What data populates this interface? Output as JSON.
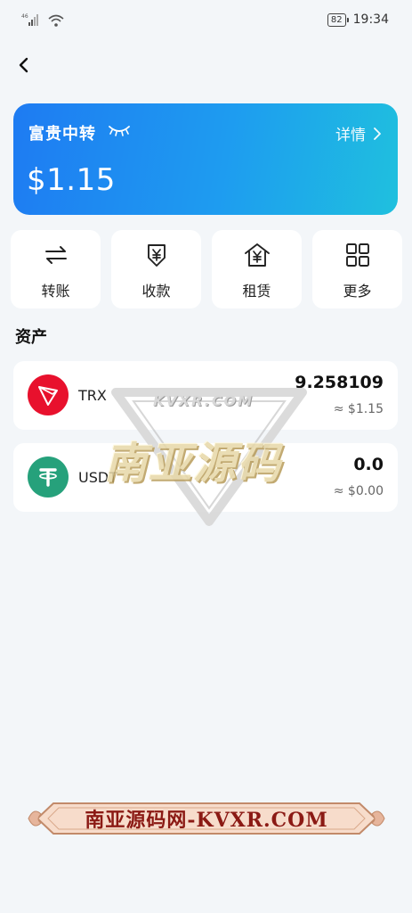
{
  "status_bar": {
    "network": "46",
    "battery": "82",
    "time": "19:34"
  },
  "wallet": {
    "name": "富贵中转",
    "detail_label": "详情",
    "balance": "$1.15"
  },
  "actions": [
    {
      "label": "转账",
      "icon": "transfer-icon"
    },
    {
      "label": "收款",
      "icon": "receive-icon"
    },
    {
      "label": "租赁",
      "icon": "lease-icon"
    },
    {
      "label": "更多",
      "icon": "grid-icon"
    }
  ],
  "assets_title": "资产",
  "assets": [
    {
      "symbol": "TRX",
      "amount": "9.258109",
      "fiat": "≈ $1.15",
      "icon": "trx-icon"
    },
    {
      "symbol": "USDT",
      "amount": "0.0",
      "fiat": "≈ $0.00",
      "icon": "usdt-icon"
    }
  ],
  "watermark": {
    "small": "KVXR.COM",
    "big": "南亚源码",
    "banner": "南亚源码网-KVXR.COM"
  },
  "colors": {
    "card_start": "#1e7bf2",
    "card_end": "#1fc0de",
    "trx": "#e8112d",
    "usdt": "#26a17b"
  }
}
